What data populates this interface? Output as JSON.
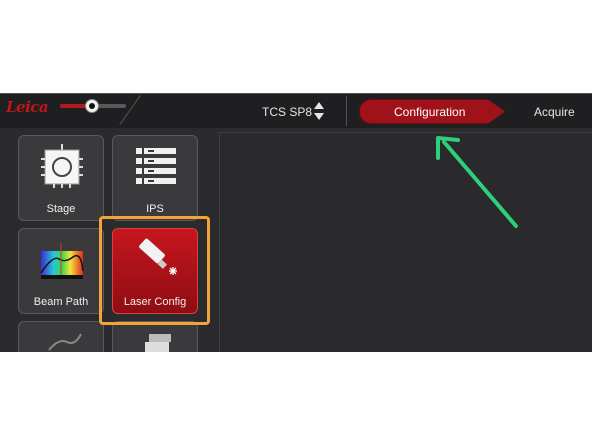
{
  "header": {
    "logo_text": "Leica",
    "system_name": "TCS SP8",
    "tabs": [
      {
        "label": "Configuration",
        "active": true
      },
      {
        "label": "Acquire",
        "active": false
      }
    ]
  },
  "tiles": [
    {
      "label": "Stage"
    },
    {
      "label": "IPS"
    },
    {
      "label": "Beam Path"
    },
    {
      "label": "Laser Config",
      "active": true
    }
  ],
  "colors": {
    "accent_red": "#a0121a",
    "highlight_orange": "#f2a33a",
    "annotation_green": "#2ecf7a"
  }
}
